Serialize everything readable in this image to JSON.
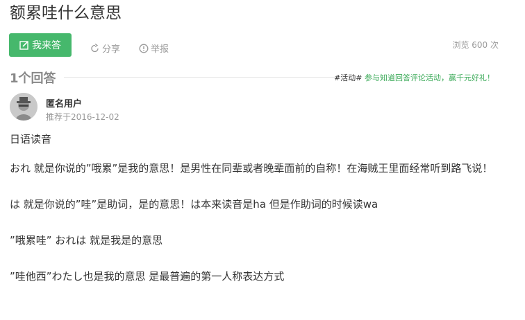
{
  "question": {
    "title": "额累哇什么意思"
  },
  "actions": {
    "answer_label": "我来答",
    "share_label": "分享",
    "report_label": "举报",
    "views": "浏览 600 次"
  },
  "answers_header": {
    "count_label": "1个回答",
    "activity_tag": "#活动#",
    "activity_text": "参与知道回答评论活动，赢千元好礼！"
  },
  "answer": {
    "author": "匿名用户",
    "recommended": "推荐于2016-12-02",
    "paragraphs": [
      "日语读音",
      "おれ 就是你说的”哦累”是我的意思！是男性在同辈或者晚辈面前的自称！在海贼王里面经常听到路飞说！",
      "は 就是你说的”哇”是助词，是的意思！は本来读音是ha 但是作助词的时候读wa",
      "”哦累哇” おれは 就是我是的意思",
      "”哇他西”わたし也是我的意思 是最普遍的第一人称表达方式"
    ]
  },
  "colors": {
    "accent_green": "#46b86c",
    "muted_gray": "#999999"
  },
  "icons": {
    "answer": "edit-icon",
    "share": "share-icon",
    "report": "report-icon",
    "avatar": "anonymous-avatar-icon"
  }
}
